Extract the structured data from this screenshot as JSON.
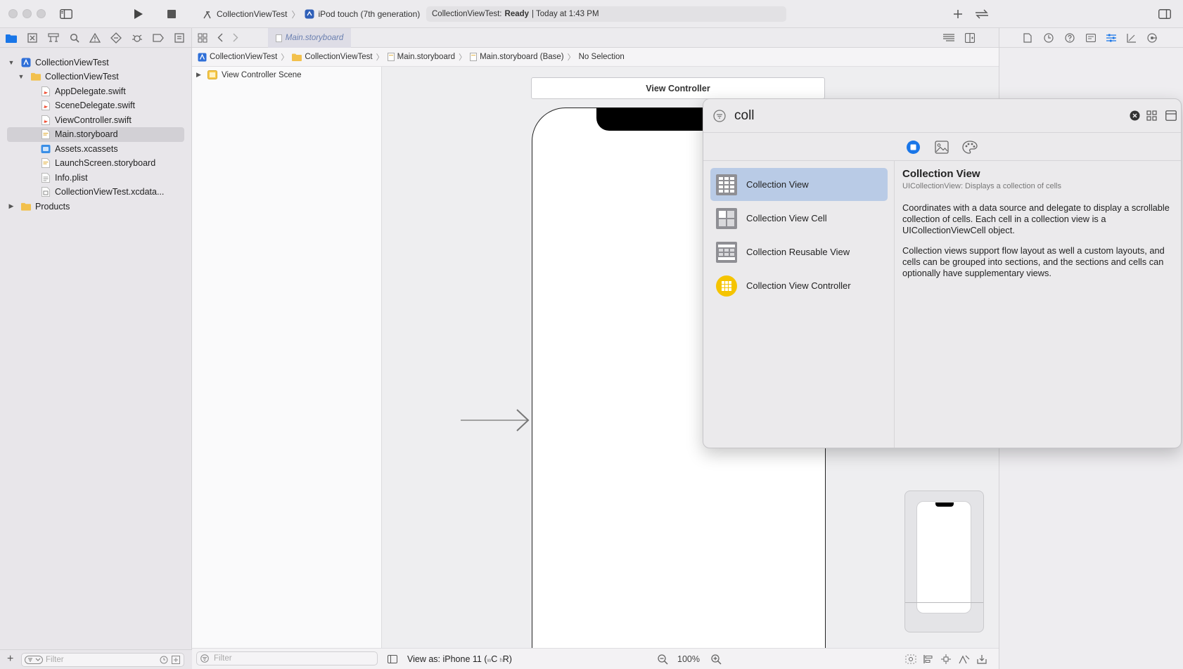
{
  "toolbar": {
    "project": "CollectionViewTest",
    "device": "iPod touch (7th generation)",
    "status_project": "CollectionViewTest:",
    "status_state": "Ready",
    "status_time": "| Today at 1:43 PM"
  },
  "navigator": {
    "tree": [
      {
        "label": "CollectionViewTest",
        "icon": "project-icon",
        "level": 0,
        "disclosure": "open"
      },
      {
        "label": "CollectionViewTest",
        "icon": "folder-icon",
        "level": 1,
        "disclosure": "open"
      },
      {
        "label": "AppDelegate.swift",
        "icon": "swift-file-icon",
        "level": 2
      },
      {
        "label": "SceneDelegate.swift",
        "icon": "swift-file-icon",
        "level": 2
      },
      {
        "label": "ViewController.swift",
        "icon": "swift-file-icon",
        "level": 2
      },
      {
        "label": "Main.storyboard",
        "icon": "storyboard-file-icon",
        "level": 2,
        "selected": true
      },
      {
        "label": "Assets.xcassets",
        "icon": "assets-icon",
        "level": 2
      },
      {
        "label": "LaunchScreen.storyboard",
        "icon": "storyboard-file-icon",
        "level": 2
      },
      {
        "label": "Info.plist",
        "icon": "plist-file-icon",
        "level": 2
      },
      {
        "label": "CollectionViewTest.xcdata...",
        "icon": "data-model-icon",
        "level": 2
      },
      {
        "label": "Products",
        "icon": "folder-icon",
        "level": 0,
        "disclosure": "closed"
      }
    ],
    "filter_placeholder": "Filter"
  },
  "editor": {
    "tab_label": "Main.storyboard",
    "breadcrumbs": [
      "CollectionViewTest",
      "CollectionViewTest",
      "Main.storyboard",
      "Main.storyboard (Base)",
      "No Selection"
    ],
    "outline_item": "View Controller Scene",
    "outline_filter_placeholder": "Filter",
    "scene_title": "View Controller",
    "view_as": "View as: iPhone 11 (",
    "view_as_size_w": "w",
    "view_as_size_c": "C",
    "view_as_size_h": "h",
    "view_as_size_r": "R)",
    "zoom": "100%"
  },
  "library": {
    "search_value": "coll",
    "items": [
      {
        "label": "Collection View",
        "icon": "collection-view-icon",
        "selected": true
      },
      {
        "label": "Collection View Cell",
        "icon": "collection-view-cell-icon"
      },
      {
        "label": "Collection Reusable View",
        "icon": "collection-reusable-view-icon"
      },
      {
        "label": "Collection View Controller",
        "icon": "collection-view-controller-icon"
      }
    ],
    "detail": {
      "title": "Collection View",
      "subtitle": "UICollectionView: Displays a collection of cells",
      "p1": "Coordinates with a data source and delegate to display a scrollable collection of cells. Each cell in a collection view is a UICollectionViewCell object.",
      "p2": "Collection views support flow layout as well a custom layouts, and cells can be grouped into sections, and the sections and cells can optionally have supplementary views."
    }
  },
  "colors": {
    "accent": "#1976e8",
    "selection": "#b9cbe6",
    "controller_yellow": "#f5c400"
  }
}
